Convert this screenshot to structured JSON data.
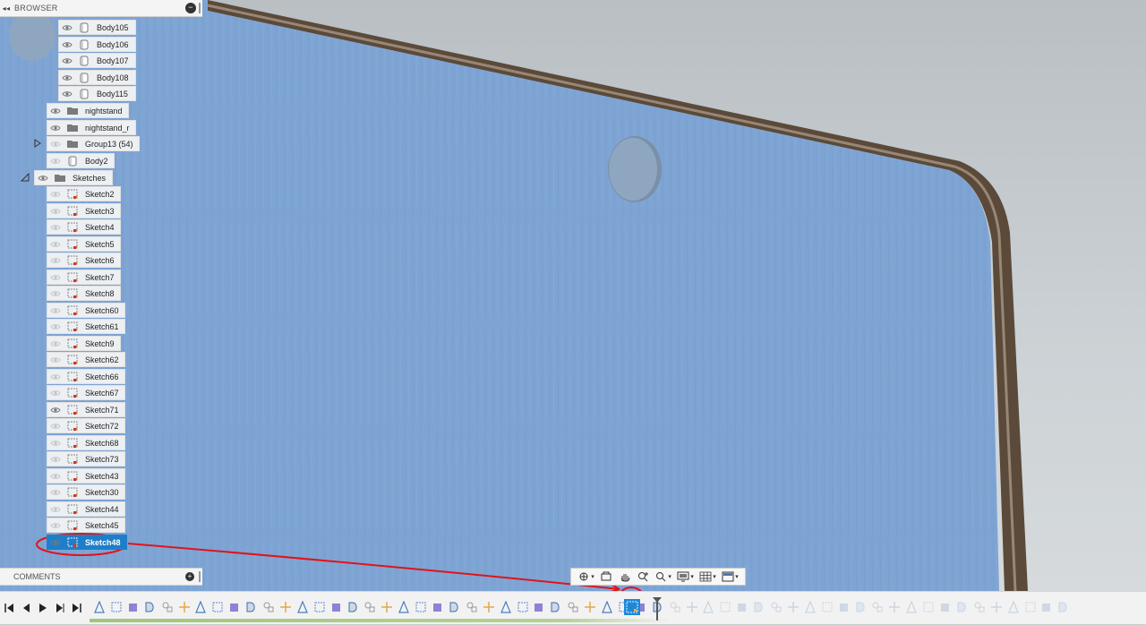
{
  "browser": {
    "title": "BROWSER",
    "collapse_glyph": "◂◂",
    "items": [
      {
        "label": "Body105",
        "type": "body"
      },
      {
        "label": "Body106",
        "type": "body"
      },
      {
        "label": "Body107",
        "type": "body"
      },
      {
        "label": "Body108",
        "type": "body"
      },
      {
        "label": "Body115",
        "type": "body"
      },
      {
        "label": "nightstand",
        "type": "folder"
      },
      {
        "label": "nightstand_r",
        "type": "folder"
      },
      {
        "label": "Group13 (54)",
        "type": "folder"
      },
      {
        "label": "Body2",
        "type": "body"
      },
      {
        "label": "Sketches",
        "type": "folder"
      },
      {
        "label": "Sketch2",
        "type": "sketch"
      },
      {
        "label": "Sketch3",
        "type": "sketch"
      },
      {
        "label": "Sketch4",
        "type": "sketch"
      },
      {
        "label": "Sketch5",
        "type": "sketch"
      },
      {
        "label": "Sketch6",
        "type": "sketch"
      },
      {
        "label": "Sketch7",
        "type": "sketch"
      },
      {
        "label": "Sketch8",
        "type": "sketch"
      },
      {
        "label": "Sketch60",
        "type": "sketch"
      },
      {
        "label": "Sketch61",
        "type": "sketch"
      },
      {
        "label": "Sketch9",
        "type": "sketch"
      },
      {
        "label": "Sketch62",
        "type": "sketch"
      },
      {
        "label": "Sketch66",
        "type": "sketch"
      },
      {
        "label": "Sketch67",
        "type": "sketch"
      },
      {
        "label": "Sketch71",
        "type": "sketch"
      },
      {
        "label": "Sketch72",
        "type": "sketch"
      },
      {
        "label": "Sketch68",
        "type": "sketch"
      },
      {
        "label": "Sketch73",
        "type": "sketch"
      },
      {
        "label": "Sketch43",
        "type": "sketch"
      },
      {
        "label": "Sketch30",
        "type": "sketch"
      },
      {
        "label": "Sketch44",
        "type": "sketch"
      },
      {
        "label": "Sketch45",
        "type": "sketch"
      },
      {
        "label": "Sketch48",
        "type": "sketch",
        "selected": true
      }
    ]
  },
  "comments": {
    "title": "COMMENTS"
  },
  "colors": {
    "accent": "#1e7fc8",
    "annotation": "#e0141a",
    "panel_face": "#7ea4d4",
    "wood_edge": "#5b4a3a"
  },
  "nav_toolbar": {
    "tools": [
      "orbit-icon",
      "look-at-icon",
      "pan-icon",
      "zoom-icon",
      "fit-icon",
      "display-settings-icon",
      "grid-settings-icon",
      "viewports-icon"
    ]
  }
}
